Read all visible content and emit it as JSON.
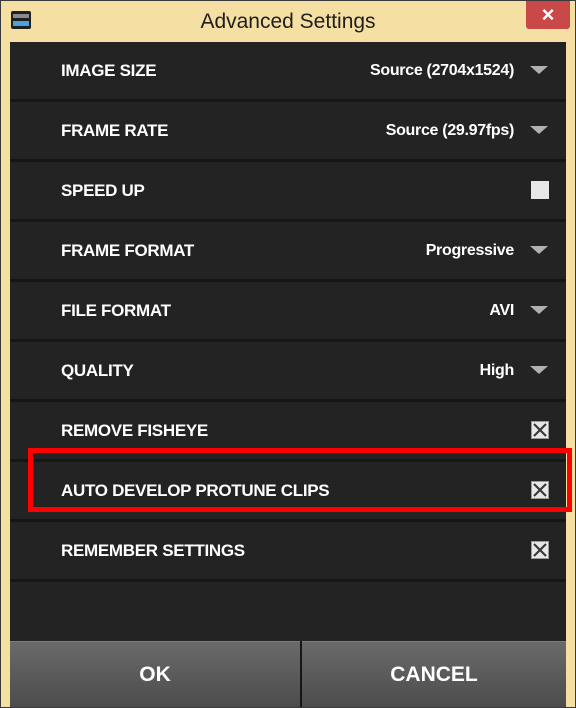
{
  "window": {
    "title": "Advanced Settings",
    "close_label": "×"
  },
  "settings": [
    {
      "label": "IMAGE SIZE",
      "type": "dropdown",
      "value": "Source (2704x1524)"
    },
    {
      "label": "FRAME RATE",
      "type": "dropdown",
      "value": "Source (29.97fps)"
    },
    {
      "label": "SPEED UP",
      "type": "checkbox",
      "checked": false
    },
    {
      "label": "FRAME FORMAT",
      "type": "dropdown",
      "value": "Progressive"
    },
    {
      "label": "FILE FORMAT",
      "type": "dropdown",
      "value": "AVI"
    },
    {
      "label": "QUALITY",
      "type": "dropdown",
      "value": "High"
    },
    {
      "label": "REMOVE FISHEYE",
      "type": "checkbox",
      "checked": true,
      "highlighted": true
    },
    {
      "label": "AUTO DEVELOP PROTUNE CLIPS",
      "type": "checkbox",
      "checked": true
    },
    {
      "label": "REMEMBER SETTINGS",
      "type": "checkbox",
      "checked": true
    }
  ],
  "buttons": {
    "ok_label": "OK",
    "cancel_label": "CANCEL"
  },
  "colors": {
    "title_bar": "#f6dfa3",
    "panel_background": "#232323",
    "close_button": "#c94848",
    "highlight_border": "#ff0000"
  },
  "icons": {
    "app": "gopro-studio-icon",
    "dropdown": "chevron-down-icon",
    "checked": "checkbox-x-icon"
  }
}
